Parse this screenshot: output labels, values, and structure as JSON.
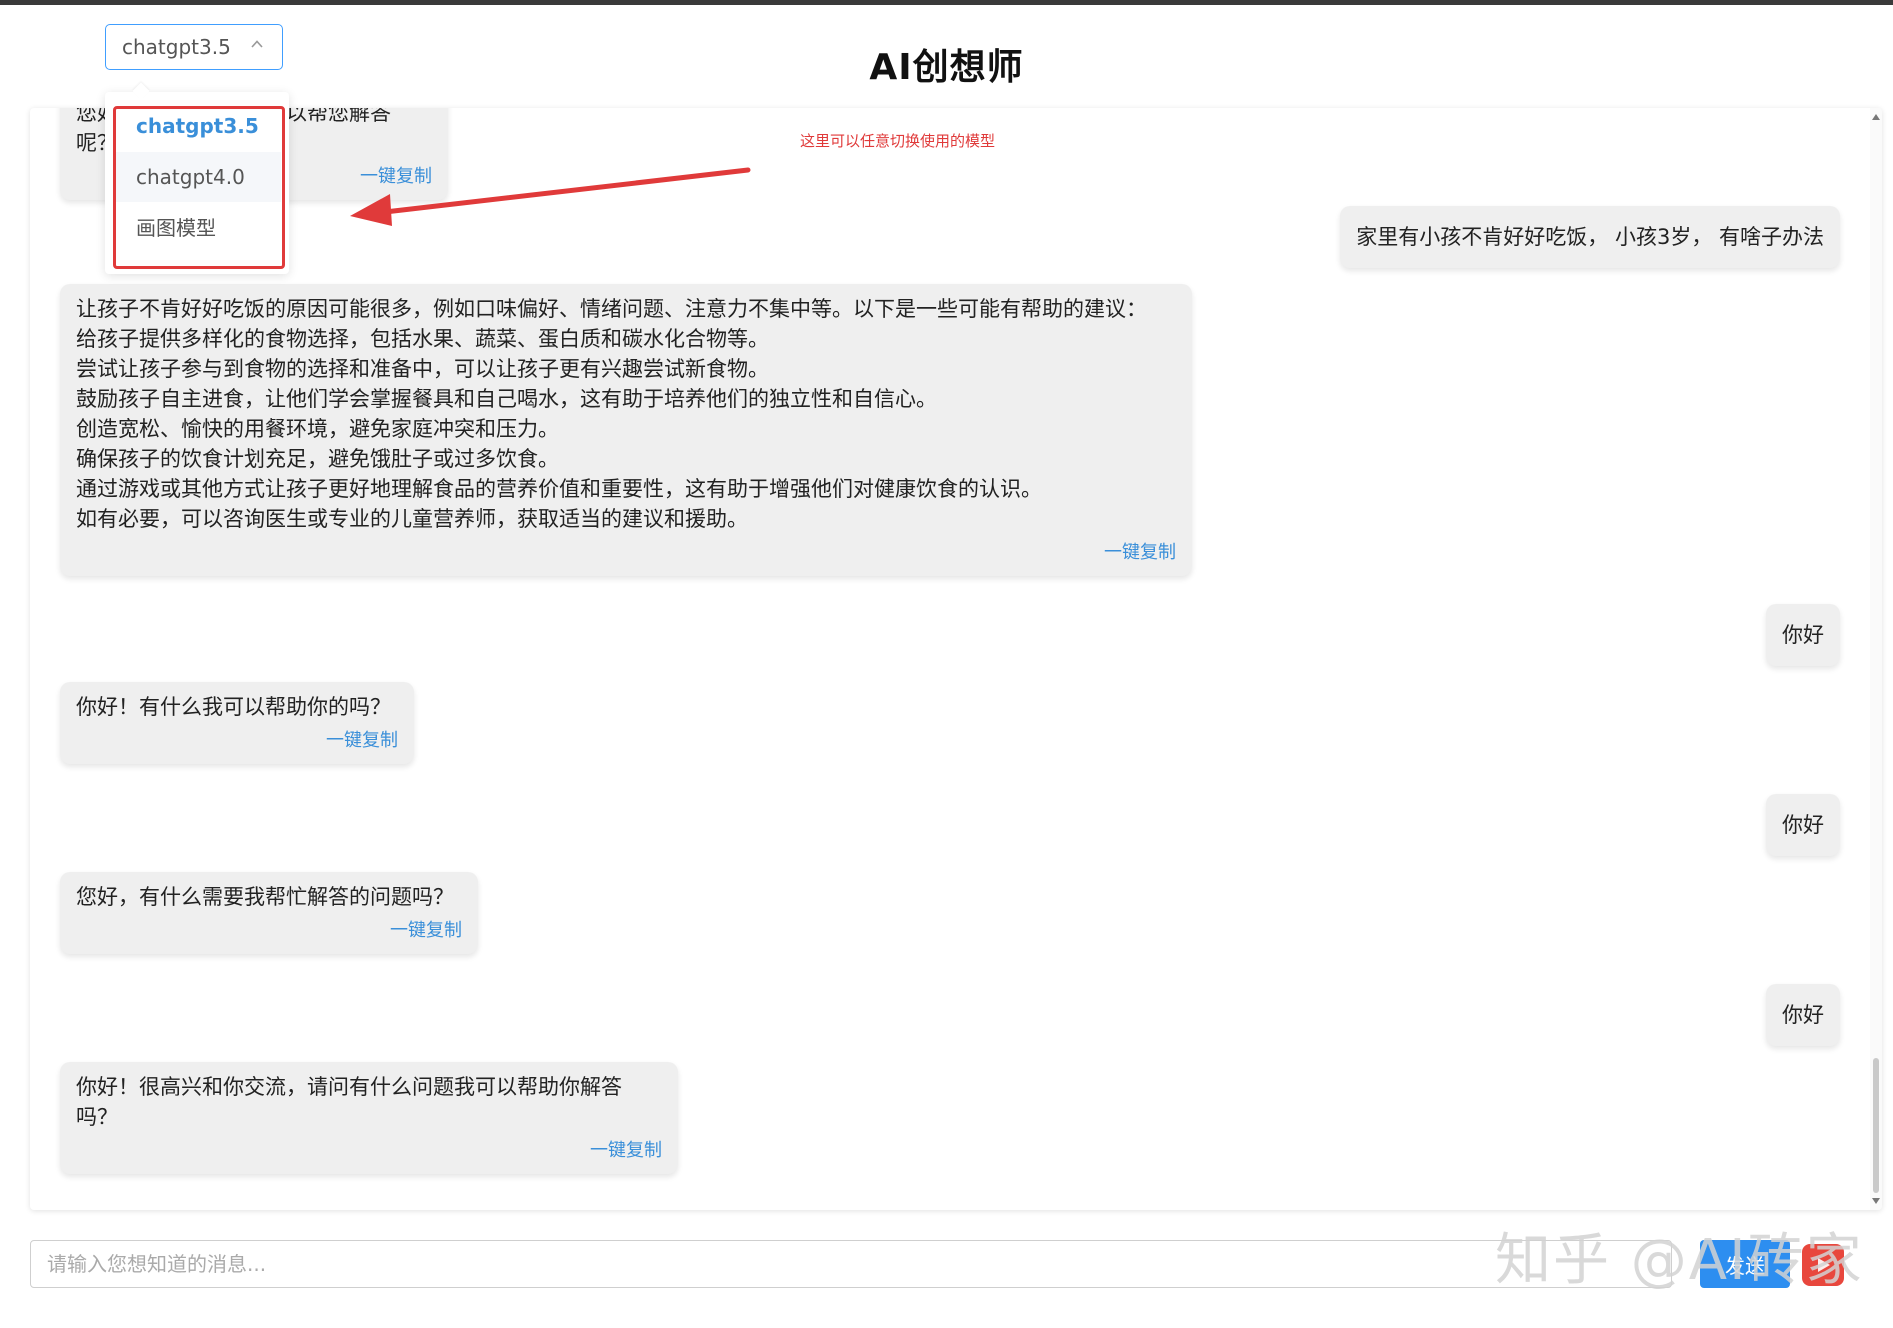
{
  "header": {
    "title": "AI创想师",
    "model_select": {
      "value": "chatgpt3.5"
    }
  },
  "model_dropdown": {
    "options": [
      "chatgpt3.5",
      "chatgpt4.0",
      "画图模型"
    ],
    "selected": "chatgpt3.5"
  },
  "annotation": {
    "text": "这里可以任意切换使用的模型",
    "color": "#e03a3a"
  },
  "chat": {
    "copy_label": "一键复制",
    "messages": [
      {
        "role": "ai",
        "text": "您好，有什么问题我可以帮您解答呢？"
      },
      {
        "role": "user",
        "text": "家里有小孩不肯好好吃饭， 小孩3岁， 有啥子办法"
      },
      {
        "role": "ai",
        "text": "让孩子不肯好好吃饭的原因可能很多，例如口味偏好、情绪问题、注意力不集中等。以下是一些可能有帮助的建议：\n给孩子提供多样化的食物选择，包括水果、蔬菜、蛋白质和碳水化合物等。\n尝试让孩子参与到食物的选择和准备中，可以让孩子更有兴趣尝试新食物。\n鼓励孩子自主进食，让他们学会掌握餐具和自己喝水，这有助于培养他们的独立性和自信心。\n创造宽松、愉快的用餐环境，避免家庭冲突和压力。\n确保孩子的饮食计划充足，避免饿肚子或过多饮食。\n通过游戏或其他方式让孩子更好地理解食品的营养价值和重要性，这有助于增强他们对健康饮食的认识。\n如有必要，可以咨询医生或专业的儿童营养师，获取适当的建议和援助。"
      },
      {
        "role": "user",
        "text": "你好"
      },
      {
        "role": "ai",
        "text": "你好！有什么我可以帮助你的吗？"
      },
      {
        "role": "user",
        "text": "你好"
      },
      {
        "role": "ai",
        "text": "您好，有什么需要我帮忙解答的问题吗？"
      },
      {
        "role": "user",
        "text": "你好"
      },
      {
        "role": "ai",
        "text": "你好！很高兴和你交流，请问有什么问题我可以帮助你解答吗？"
      }
    ]
  },
  "composer": {
    "placeholder": "请输入您想知道的消息...",
    "value": "",
    "send_label": "发送"
  },
  "watermark": {
    "text": "知乎 @AI砖家"
  },
  "colors": {
    "accent": "#409eff",
    "link": "#3a8fd9",
    "send_button": "#2d8ef0",
    "highlight_red": "#e03a3a",
    "bubble_bg": "#efefef"
  }
}
